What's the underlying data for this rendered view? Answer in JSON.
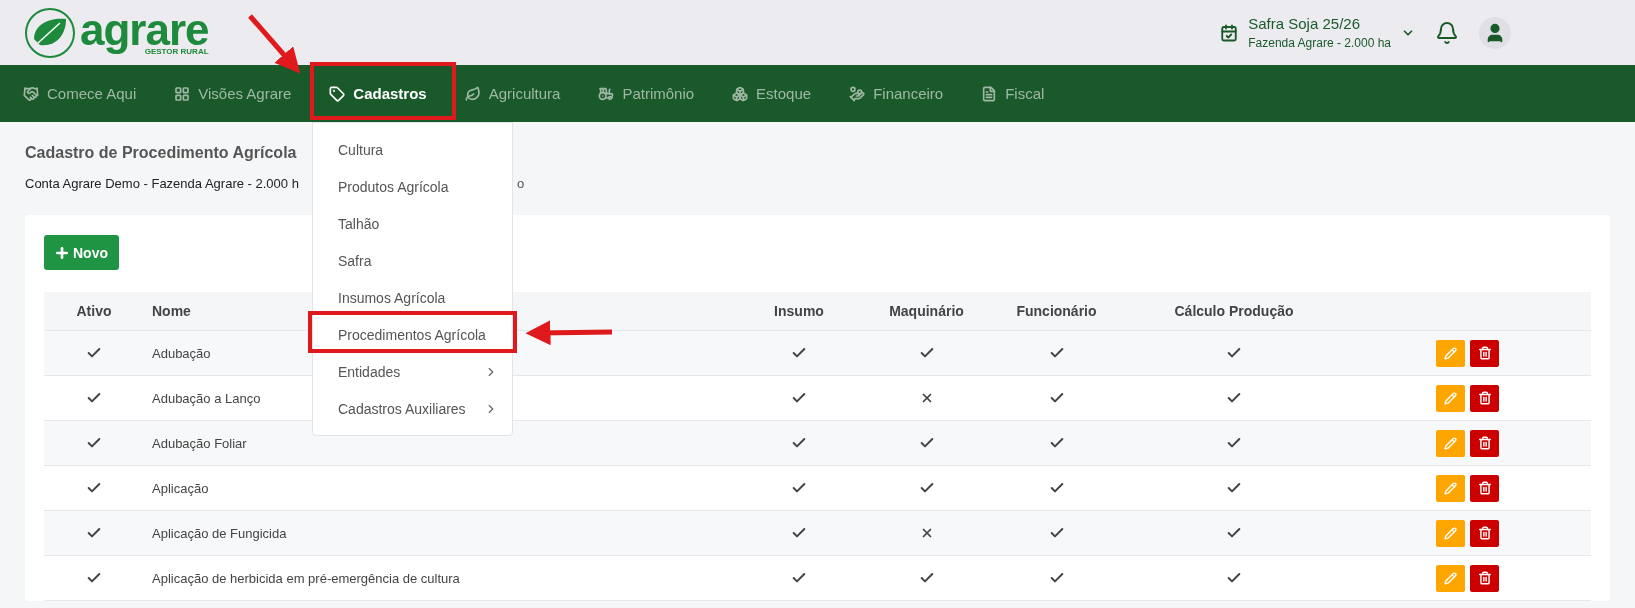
{
  "logo": {
    "name": "agrare",
    "tagline": "GESTOR RURAL"
  },
  "header": {
    "season": "Safra Soja 25/26",
    "farm": "Fazenda Agrare - 2.000 ha"
  },
  "nav": [
    {
      "label": "Comece Aqui",
      "selected": false
    },
    {
      "label": "Visões Agrare",
      "selected": false
    },
    {
      "label": "Cadastros",
      "selected": true
    },
    {
      "label": "Agricultura",
      "selected": false
    },
    {
      "label": "Patrimônio",
      "selected": false
    },
    {
      "label": "Estoque",
      "selected": false
    },
    {
      "label": "Financeiro",
      "selected": false
    },
    {
      "label": "Fiscal",
      "selected": false
    }
  ],
  "menu": [
    {
      "label": "Cultura",
      "submenu": false
    },
    {
      "label": "Produtos Agrícola",
      "submenu": false
    },
    {
      "label": "Talhão",
      "submenu": false
    },
    {
      "label": "Safra",
      "submenu": false
    },
    {
      "label": "Insumos Agrícola",
      "submenu": false
    },
    {
      "label": "Procedimentos Agrícola",
      "submenu": false
    },
    {
      "label": "Entidades",
      "submenu": true
    },
    {
      "label": "Cadastros Auxiliares",
      "submenu": true
    }
  ],
  "page": {
    "title": "Cadastro de Procedimento Agrícola",
    "subtitle": "Conta Agrare Demo - Fazenda Agrare - 2.000 h",
    "subtitle_tail": "o"
  },
  "new_button": "Novo",
  "table": {
    "columns": [
      "Ativo",
      "Nome",
      "Insumo",
      "Maquinário",
      "Funcionário",
      "Cálculo Produção"
    ],
    "rows": [
      {
        "ativo": true,
        "nome": "Adubação",
        "insumo": true,
        "maquinario": true,
        "funcionario": true,
        "calculo": true
      },
      {
        "ativo": true,
        "nome": "Adubação a Lanço",
        "insumo": true,
        "maquinario": false,
        "funcionario": true,
        "calculo": true
      },
      {
        "ativo": true,
        "nome": "Adubação Foliar",
        "insumo": true,
        "maquinario": true,
        "funcionario": true,
        "calculo": true
      },
      {
        "ativo": true,
        "nome": "Aplicação",
        "insumo": true,
        "maquinario": true,
        "funcionario": true,
        "calculo": true
      },
      {
        "ativo": true,
        "nome": "Aplicação de Fungicida",
        "insumo": true,
        "maquinario": false,
        "funcionario": true,
        "calculo": true
      },
      {
        "ativo": true,
        "nome": "Aplicação de herbicida em pré-emergência de cultura",
        "insumo": true,
        "maquinario": true,
        "funcionario": true,
        "calculo": true
      }
    ]
  }
}
